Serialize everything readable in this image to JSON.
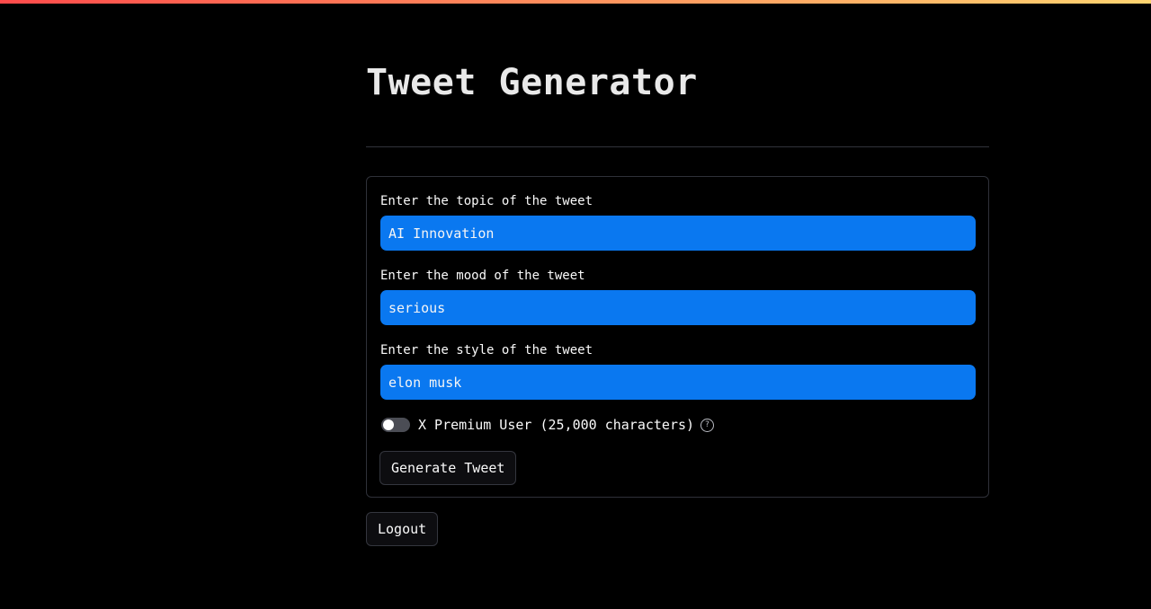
{
  "page": {
    "title": "Tweet Generator"
  },
  "form": {
    "topic": {
      "label": "Enter the topic of the tweet",
      "value": "AI Innovation"
    },
    "mood": {
      "label": "Enter the mood of the tweet",
      "value": "serious"
    },
    "style": {
      "label": "Enter the style of the tweet",
      "value": "elon musk"
    },
    "premium_toggle": {
      "label": "X Premium User (25,000 characters)",
      "checked": false,
      "help_icon": "question-circle-icon"
    },
    "submit_label": "Generate Tweet"
  },
  "logout_label": "Logout",
  "colors": {
    "background": "#000000",
    "input_fill": "#0a78f0",
    "accent_bar": [
      "#ff4b4b",
      "#ffd470"
    ]
  }
}
